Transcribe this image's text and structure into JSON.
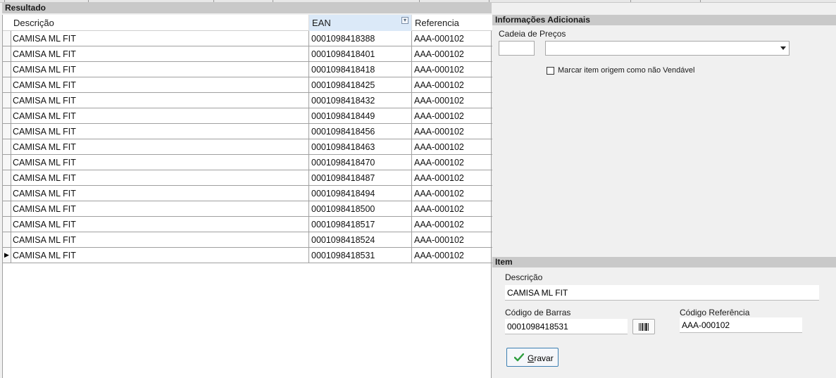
{
  "resultado": {
    "title": "Resultado",
    "columns": [
      "Descrição",
      "EAN",
      "Referencia"
    ],
    "rows": [
      [
        "CAMISA ML FIT",
        "0001098418388",
        "AAA-000102"
      ],
      [
        "CAMISA ML FIT",
        "0001098418401",
        "AAA-000102"
      ],
      [
        "CAMISA ML FIT",
        "0001098418418",
        "AAA-000102"
      ],
      [
        "CAMISA ML FIT",
        "0001098418425",
        "AAA-000102"
      ],
      [
        "CAMISA ML FIT",
        "0001098418432",
        "AAA-000102"
      ],
      [
        "CAMISA ML FIT",
        "0001098418449",
        "AAA-000102"
      ],
      [
        "CAMISA ML FIT",
        "0001098418456",
        "AAA-000102"
      ],
      [
        "CAMISA ML FIT",
        "0001098418463",
        "AAA-000102"
      ],
      [
        "CAMISA ML FIT",
        "0001098418470",
        "AAA-000102"
      ],
      [
        "CAMISA ML FIT",
        "0001098418487",
        "AAA-000102"
      ],
      [
        "CAMISA ML FIT",
        "0001098418494",
        "AAA-000102"
      ],
      [
        "CAMISA ML FIT",
        "0001098418500",
        "AAA-000102"
      ],
      [
        "CAMISA ML FIT",
        "0001098418517",
        "AAA-000102"
      ],
      [
        "CAMISA ML FIT",
        "0001098418524",
        "AAA-000102"
      ],
      [
        "CAMISA ML FIT",
        "0001098418531",
        "AAA-000102"
      ]
    ],
    "current_row_marker": "▶"
  },
  "info": {
    "title": "Informações Adicionais",
    "cadeia_label": "Cadeia de Preços",
    "cadeia_code": "",
    "cadeia_value": "",
    "checkbox_label": "Marcar item origem como não Vendável",
    "checkbox_checked": false
  },
  "item": {
    "title": "Item",
    "descricao_label": "Descrição",
    "descricao_value": "CAMISA ML FIT",
    "codigo_barras_label": "Código de Barras",
    "codigo_barras_value": "0001098418531",
    "codigo_ref_label": "Código Referência",
    "codigo_ref_value": "AAA-000102",
    "save_label": "Gravar",
    "save_mnemonic": "G",
    "save_rest": "ravar"
  },
  "colors": {
    "section_header": "#c9c9c9",
    "selected_header": "#dbe9f8",
    "save_border": "#3c7fb1",
    "check_green": "#2e9e3e"
  },
  "icons": {
    "filter": "filter-icon",
    "barcode": "barcode-icon",
    "save": "checkmark-icon",
    "dropdown": "chevron-down-icon"
  }
}
